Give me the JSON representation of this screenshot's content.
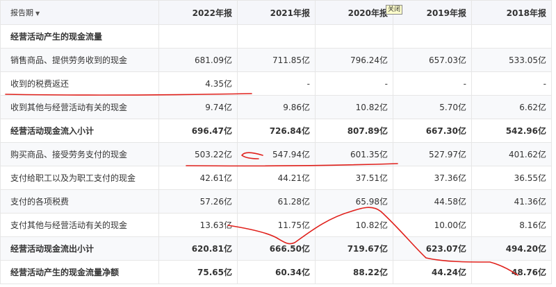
{
  "header": {
    "period_label": "报告期",
    "years": [
      "2022年报",
      "2021年报",
      "2020年报",
      "2019年报",
      "2018年报"
    ],
    "close_label": "关闭"
  },
  "rows": [
    {
      "label": "经营活动产生的现金流量",
      "values": [
        "",
        "",
        "",
        "",
        ""
      ],
      "bold": true
    },
    {
      "label": "销售商品、提供劳务收到的现金",
      "values": [
        "681.09亿",
        "711.85亿",
        "796.24亿",
        "657.03亿",
        "533.05亿"
      ],
      "bold": false
    },
    {
      "label": "收到的税费返还",
      "values": [
        "4.35亿",
        "-",
        "-",
        "-",
        "-"
      ],
      "bold": false
    },
    {
      "label": "收到其他与经营活动有关的现金",
      "values": [
        "9.74亿",
        "9.86亿",
        "10.82亿",
        "5.70亿",
        "6.62亿"
      ],
      "bold": false
    },
    {
      "label": "经营活动现金流入小计",
      "values": [
        "696.47亿",
        "726.84亿",
        "807.89亿",
        "667.30亿",
        "542.96亿"
      ],
      "bold": true
    },
    {
      "label": "购买商品、接受劳务支付的现金",
      "values": [
        "503.22亿",
        "547.94亿",
        "601.35亿",
        "527.97亿",
        "401.62亿"
      ],
      "bold": false
    },
    {
      "label": "支付给职工以及为职工支付的现金",
      "values": [
        "42.61亿",
        "44.21亿",
        "37.51亿",
        "37.36亿",
        "36.55亿"
      ],
      "bold": false
    },
    {
      "label": "支付的各项税费",
      "values": [
        "57.26亿",
        "61.28亿",
        "65.98亿",
        "44.58亿",
        "41.36亿"
      ],
      "bold": false
    },
    {
      "label": "支付其他与经营活动有关的现金",
      "values": [
        "13.63亿",
        "11.75亿",
        "10.82亿",
        "10.00亿",
        "8.16亿"
      ],
      "bold": false
    },
    {
      "label": "经营活动现金流出小计",
      "values": [
        "620.81亿",
        "666.50亿",
        "719.67亿",
        "623.07亿",
        "494.20亿"
      ],
      "bold": true
    },
    {
      "label": "经营活动产生的现金流量净额",
      "values": [
        "75.65亿",
        "60.34亿",
        "88.22亿",
        "44.24亿",
        "48.76亿"
      ],
      "bold": true
    }
  ],
  "colors": {
    "annotation": "#e0201b",
    "header_bg": "#f5f6fa",
    "border": "#e6e6e6"
  }
}
